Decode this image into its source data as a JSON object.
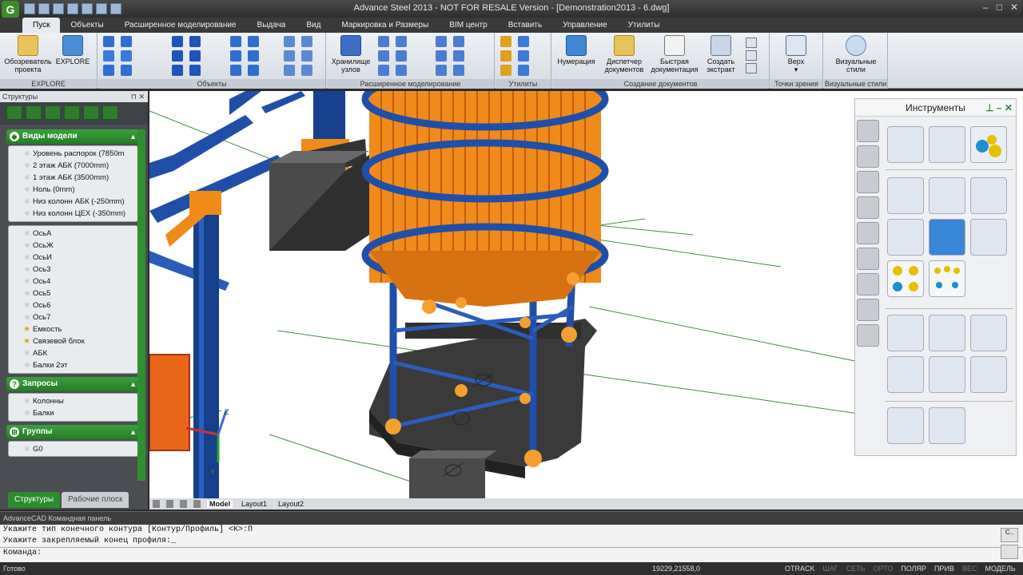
{
  "window": {
    "title": "Advance Steel 2013 - NOT FOR RESALE Version - [Demonstration2013 - 6.dwg]",
    "app_logo": "G",
    "controls": [
      "–",
      "□",
      "✕"
    ]
  },
  "ribbon": {
    "tabs": [
      "Пуск",
      "Объекты",
      "Расширенное моделирование",
      "Выдача",
      "Вид",
      "Маркировка и Размеры",
      "BIM центр",
      "Вставить",
      "Управление",
      "Утилиты"
    ],
    "active_tab": "Пуск",
    "groups": {
      "explore": {
        "label": "EXPLORE",
        "btn1": "Обозреватель проекта",
        "btn2": "EXPLORE"
      },
      "objects": {
        "label": "Объекты"
      },
      "advanced": {
        "label": "Расширенное моделирование",
        "btn1": "Хранилище узлов"
      },
      "utilities": {
        "label": "Утилиты"
      },
      "docs": {
        "label": "Создание документов",
        "btn1": "Нумерация",
        "btn2": "Диспетчер документов",
        "btn3": "Быстрая документация",
        "btn4": "Создать экстракт"
      },
      "viewpoints": {
        "label": "Точки зрения",
        "btn1": "Верх"
      },
      "visual": {
        "label": "Визуальные стили",
        "btn1": "Визуальные стили"
      }
    }
  },
  "left_panel": {
    "title": "Структуры",
    "sections": {
      "models": {
        "header": "Виды модели",
        "items": [
          "Уровень распорок (7850m",
          "2 этаж АБК (7000mm)",
          "1 этаж АБК (3500mm)",
          "Ноль (0mm)",
          "Низ колонн АБК (-250mm)",
          "Низ колонн ЦЕХ (-350mm)"
        ],
        "axes": [
          "ОсьА",
          "ОсьЖ",
          "ОсьИ",
          "Ось3",
          "Ось4",
          "Ось5",
          "Ось6",
          "Ось7",
          "Емкость",
          "Связевой блок",
          "АБК",
          "Балки 2эт"
        ]
      },
      "queries": {
        "header": "Запросы",
        "items": [
          "Колонны",
          "Балки"
        ]
      },
      "groups": {
        "header": "Группы",
        "items": [
          "G0"
        ]
      }
    },
    "bottom_tabs": [
      "Структуры",
      "Рабочие плоск"
    ]
  },
  "viewport": {
    "layout_tabs": [
      "Model",
      "Layout1",
      "Layout2"
    ],
    "active_layout": "Model",
    "ucs": {
      "x": "X",
      "y": "Y",
      "z": "Z"
    }
  },
  "tools_palette": {
    "title": "Инструменты"
  },
  "command": {
    "title": "AdvanceCAD Командная панель",
    "lines": [
      "Укажите тип конечного контура [Контур/Профиль] <К>:П",
      "Укажите закрепляемый конец профиля:_"
    ],
    "prompt": "Команда:",
    "side_btn": "C.."
  },
  "status": {
    "ready": "Готово",
    "coords": "19229,21558,0",
    "toggles": [
      {
        "label": "OTRACK",
        "on": true
      },
      {
        "label": "ШАГ",
        "on": false
      },
      {
        "label": "СЕТЬ",
        "on": false
      },
      {
        "label": "ОРТО",
        "on": false
      },
      {
        "label": "ПОЛЯР",
        "on": true
      },
      {
        "label": "ПРИВ",
        "on": true
      },
      {
        "label": "ВЕС",
        "on": false
      },
      {
        "label": "МОДЕЛЬ",
        "on": true
      }
    ]
  },
  "colors": {
    "accent_green": "#2c8c2c",
    "steel_blue": "#1f4fa8",
    "tank_orange": "#f08a1a",
    "concrete": "#555555"
  }
}
